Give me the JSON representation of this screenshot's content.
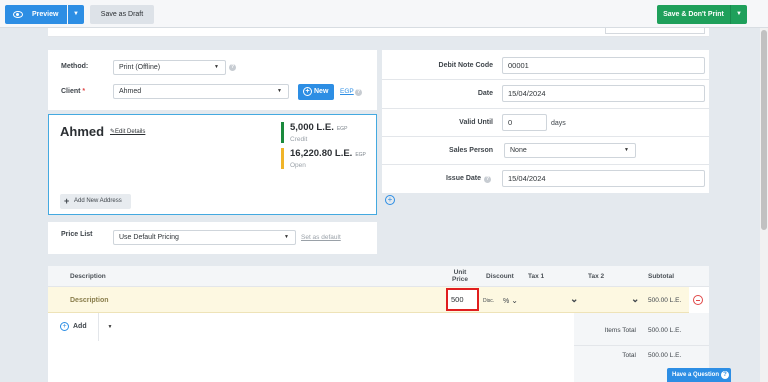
{
  "toolbar": {
    "preview_label": "Preview",
    "save_draft_label": "Save as Draft",
    "save_no_print_label": "Save & Don't Print"
  },
  "form": {
    "method_label": "Method:",
    "method_value": "Print (Offline)",
    "client_label": "Client",
    "client_value": "Ahmed",
    "new_label": "New",
    "currency_link": "EGP",
    "price_list_label": "Price List",
    "price_list_value": "Use Default Pricing",
    "set_default_link": "Set as default"
  },
  "client_card": {
    "name": "Ahmed",
    "edit_label": "Edit Details",
    "credit_amount": "5,000 L.E.",
    "credit_currency": "EGP",
    "credit_tag": "Credit",
    "open_amount": "16,220.80 L.E.",
    "open_currency": "EGP",
    "open_tag": "Open",
    "add_address_label": "Add New Address"
  },
  "details": {
    "debit_note_code_label": "Debit Note Code",
    "debit_note_code_value": "00001",
    "date_label": "Date",
    "date_value": "15/04/2024",
    "valid_until_label": "Valid Until",
    "valid_until_value": "0",
    "valid_until_unit": "days",
    "sales_person_label": "Sales Person",
    "sales_person_value": "None",
    "issue_date_label": "Issue Date",
    "issue_date_value": "15/04/2024"
  },
  "items": {
    "headers": {
      "description": "Description",
      "unit_price_line1": "Unit",
      "unit_price_line2": "Price",
      "discount": "Discount",
      "tax1": "Tax 1",
      "tax2": "Tax 2",
      "subtotal": "Subtotal"
    },
    "row": {
      "description": "Description",
      "unit_price": "500",
      "disc_label": "Disc.",
      "disc_type": "%",
      "subtotal": "500.00 L.E."
    },
    "add_label": "Add",
    "items_total_label": "Items Total",
    "items_total_value": "500.00 L.E.",
    "total_label": "Total",
    "total_value": "500.00 L.E."
  },
  "help": {
    "question_label": "Have a Question"
  },
  "colors": {
    "primary": "#2d8ee4",
    "success": "#1fa05b",
    "credit_bar": "#1a8a3c",
    "open_bar": "#f0b429",
    "highlight_border": "#e01e1e"
  }
}
